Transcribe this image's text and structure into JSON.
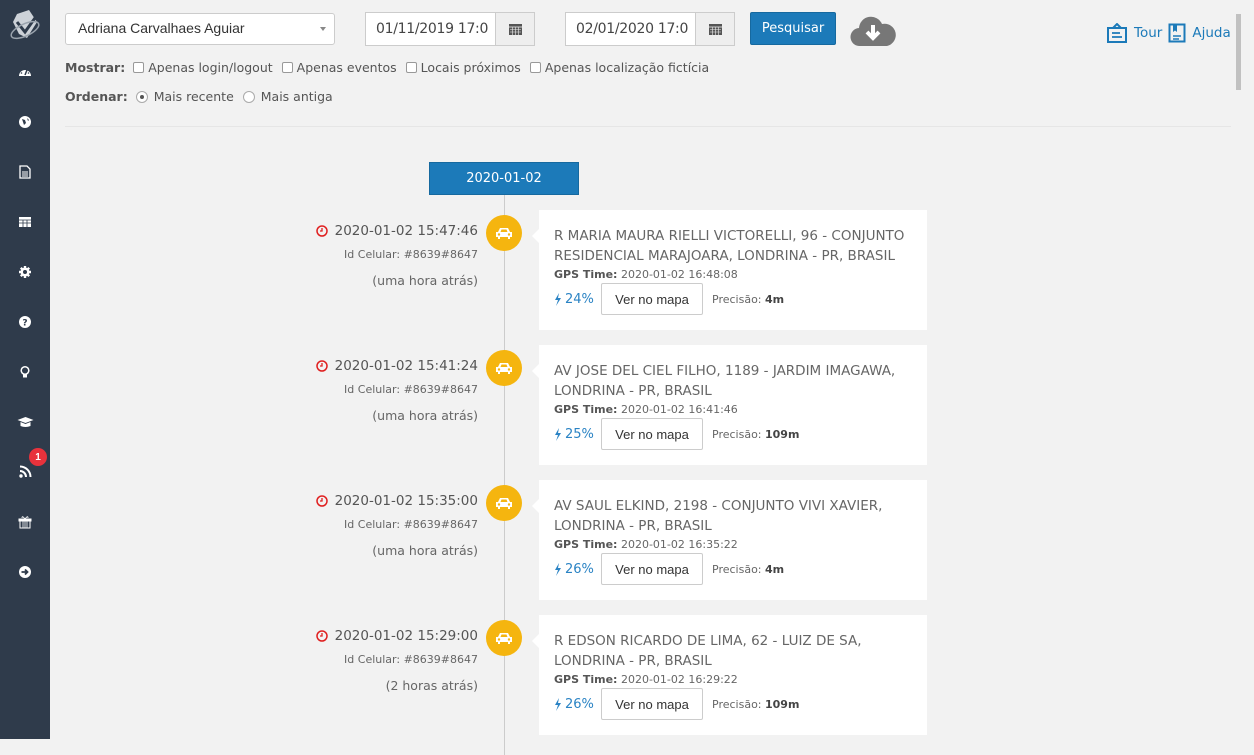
{
  "sidebar": {
    "items": [
      {
        "icon": "dashboard-icon"
      },
      {
        "icon": "globe-icon"
      },
      {
        "icon": "document-icon"
      },
      {
        "icon": "table-icon"
      },
      {
        "icon": "gear-icon"
      },
      {
        "icon": "question-icon"
      },
      {
        "icon": "lightbulb-icon"
      },
      {
        "icon": "graduation-cap-icon"
      },
      {
        "icon": "rss-icon",
        "badge": "1"
      },
      {
        "icon": "gift-icon"
      },
      {
        "icon": "logout-icon"
      }
    ]
  },
  "filters": {
    "user_select": "Adriana Carvalhaes Aguiar",
    "date_from": "01/11/2019 17:0",
    "date_to": "02/01/2020 17:0",
    "search_label": "Pesquisar",
    "show_label": "Mostrar:",
    "show_options": [
      "Apenas login/logout",
      "Apenas eventos",
      "Locais próximos",
      "Apenas localização fictícia"
    ],
    "order_label": "Ordenar:",
    "order_options": [
      "Mais recente",
      "Mais antiga"
    ],
    "order_selected": "Mais recente"
  },
  "top_links": {
    "tour": "Tour",
    "help": "Ajuda"
  },
  "timeline": {
    "date": "2020-01-02",
    "entries": [
      {
        "timestamp": "2020-01-02 15:47:46",
        "id_celular": "Id Celular: #8639#8647",
        "ago": "(uma hora atrás)",
        "address": "R MARIA MAURA RIELLI VICTORELLI, 96 - CONJUNTO RESIDENCIAL MARAJOARA, LONDRINA - PR, BRASIL",
        "gps_label": "GPS Time:",
        "gps_time": "2020-01-02 16:48:08",
        "battery": "24%",
        "map_button": "Ver no mapa",
        "precision_label": "Precisão:",
        "precision": "4m"
      },
      {
        "timestamp": "2020-01-02 15:41:24",
        "id_celular": "Id Celular: #8639#8647",
        "ago": "(uma hora atrás)",
        "address": "AV JOSE DEL CIEL FILHO, 1189 - JARDIM IMAGAWA, LONDRINA - PR, BRASIL",
        "gps_label": "GPS Time:",
        "gps_time": "2020-01-02 16:41:46",
        "battery": "25%",
        "map_button": "Ver no mapa",
        "precision_label": "Precisão:",
        "precision": "109m"
      },
      {
        "timestamp": "2020-01-02 15:35:00",
        "id_celular": "Id Celular: #8639#8647",
        "ago": "(uma hora atrás)",
        "address": "AV SAUL ELKIND, 2198 - CONJUNTO VIVI XAVIER, LONDRINA - PR, BRASIL",
        "gps_label": "GPS Time:",
        "gps_time": "2020-01-02 16:35:22",
        "battery": "26%",
        "map_button": "Ver no mapa",
        "precision_label": "Precisão:",
        "precision": "4m"
      },
      {
        "timestamp": "2020-01-02 15:29:00",
        "id_celular": "Id Celular: #8639#8647",
        "ago": "(2 horas atrás)",
        "address": "R EDSON RICARDO DE LIMA, 62 - LUIZ DE SA, LONDRINA - PR, BRASIL",
        "gps_label": "GPS Time:",
        "gps_time": "2020-01-02 16:29:22",
        "battery": "26%",
        "map_button": "Ver no mapa",
        "precision_label": "Precisão:",
        "precision": "109m"
      }
    ]
  },
  "colors": {
    "sidebar_bg": "#2f3b4b",
    "primary": "#1c7ab9",
    "marker": "#f5b50f",
    "badge": "#e8323c",
    "clock": "#e02020"
  }
}
